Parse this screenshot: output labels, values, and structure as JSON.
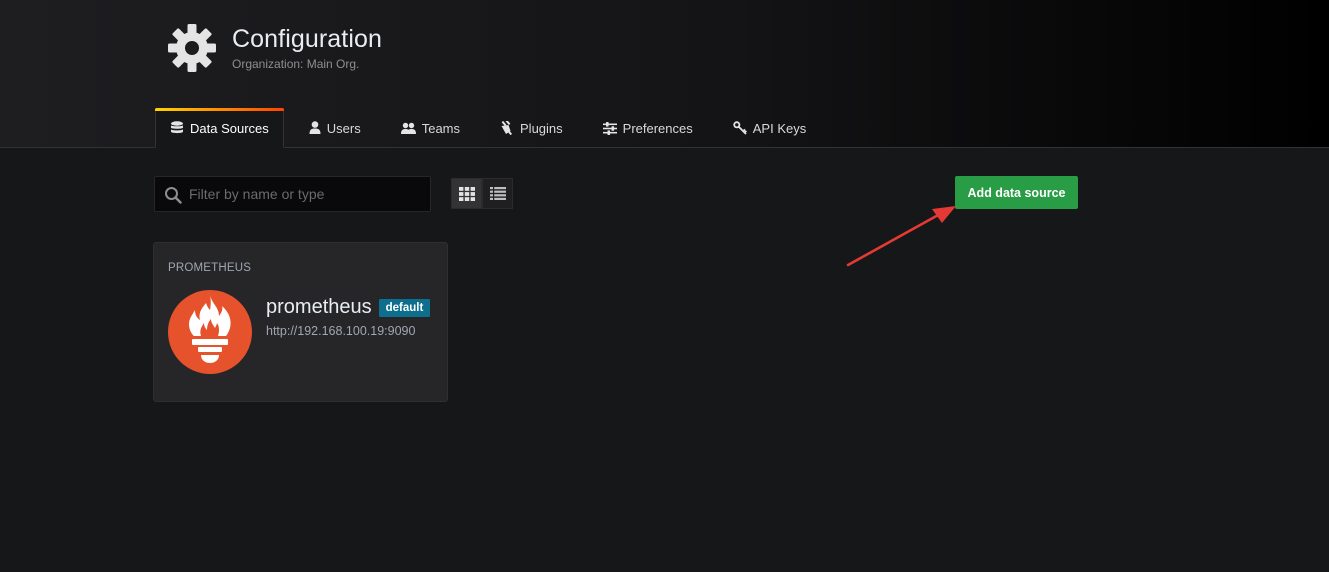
{
  "header": {
    "title": "Configuration",
    "subtitle": "Organization: Main Org.",
    "icon": "gear-icon"
  },
  "tabs": [
    {
      "label": "Data Sources",
      "icon": "database-icon",
      "active": true
    },
    {
      "label": "Users",
      "icon": "user-icon",
      "active": false
    },
    {
      "label": "Teams",
      "icon": "users-icon",
      "active": false
    },
    {
      "label": "Plugins",
      "icon": "plug-icon",
      "active": false
    },
    {
      "label": "Preferences",
      "icon": "sliders-icon",
      "active": false
    },
    {
      "label": "API Keys",
      "icon": "key-icon",
      "active": false
    }
  ],
  "search": {
    "placeholder": "Filter by name or type",
    "value": ""
  },
  "view_toggle": {
    "selected": "grid"
  },
  "add_button": {
    "label": "Add data source"
  },
  "datasources": [
    {
      "type": "PROMETHEUS",
      "name": "prometheus",
      "badge": "default",
      "url": "http://192.168.100.19:9090"
    }
  ],
  "colors": {
    "accent_green": "#299c46",
    "badge_blue": "#0d6e8e",
    "prometheus_orange": "#e6522c",
    "annotation_arrow": "#e53935"
  }
}
